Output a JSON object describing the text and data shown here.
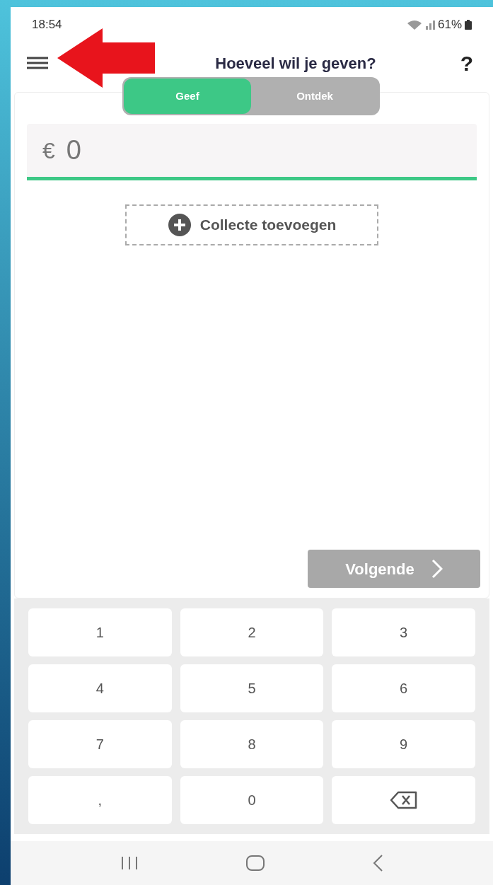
{
  "status_bar": {
    "time": "18:54",
    "battery": "61%"
  },
  "header": {
    "title": "Hoeveel wil je geven?",
    "help": "?"
  },
  "tabs": [
    {
      "label": "Geef",
      "selected": true
    },
    {
      "label": "Ontdek",
      "selected": false
    }
  ],
  "amount": {
    "currency": "€",
    "value": "0"
  },
  "add_collection": {
    "label": "Collecte toevoegen"
  },
  "next_button": {
    "label": "Volgende",
    "disabled": true
  },
  "keypad": [
    {
      "kind": "key",
      "label": "1"
    },
    {
      "kind": "key",
      "label": "2"
    },
    {
      "kind": "key",
      "label": "3"
    },
    {
      "kind": "key",
      "label": "4"
    },
    {
      "kind": "key",
      "label": "5"
    },
    {
      "kind": "key",
      "label": "6"
    },
    {
      "kind": "key",
      "label": "7"
    },
    {
      "kind": "key",
      "label": "8"
    },
    {
      "kind": "key",
      "label": "9"
    },
    {
      "kind": "key",
      "label": ","
    },
    {
      "kind": "key",
      "label": "0"
    },
    {
      "kind": "backspace"
    }
  ]
}
